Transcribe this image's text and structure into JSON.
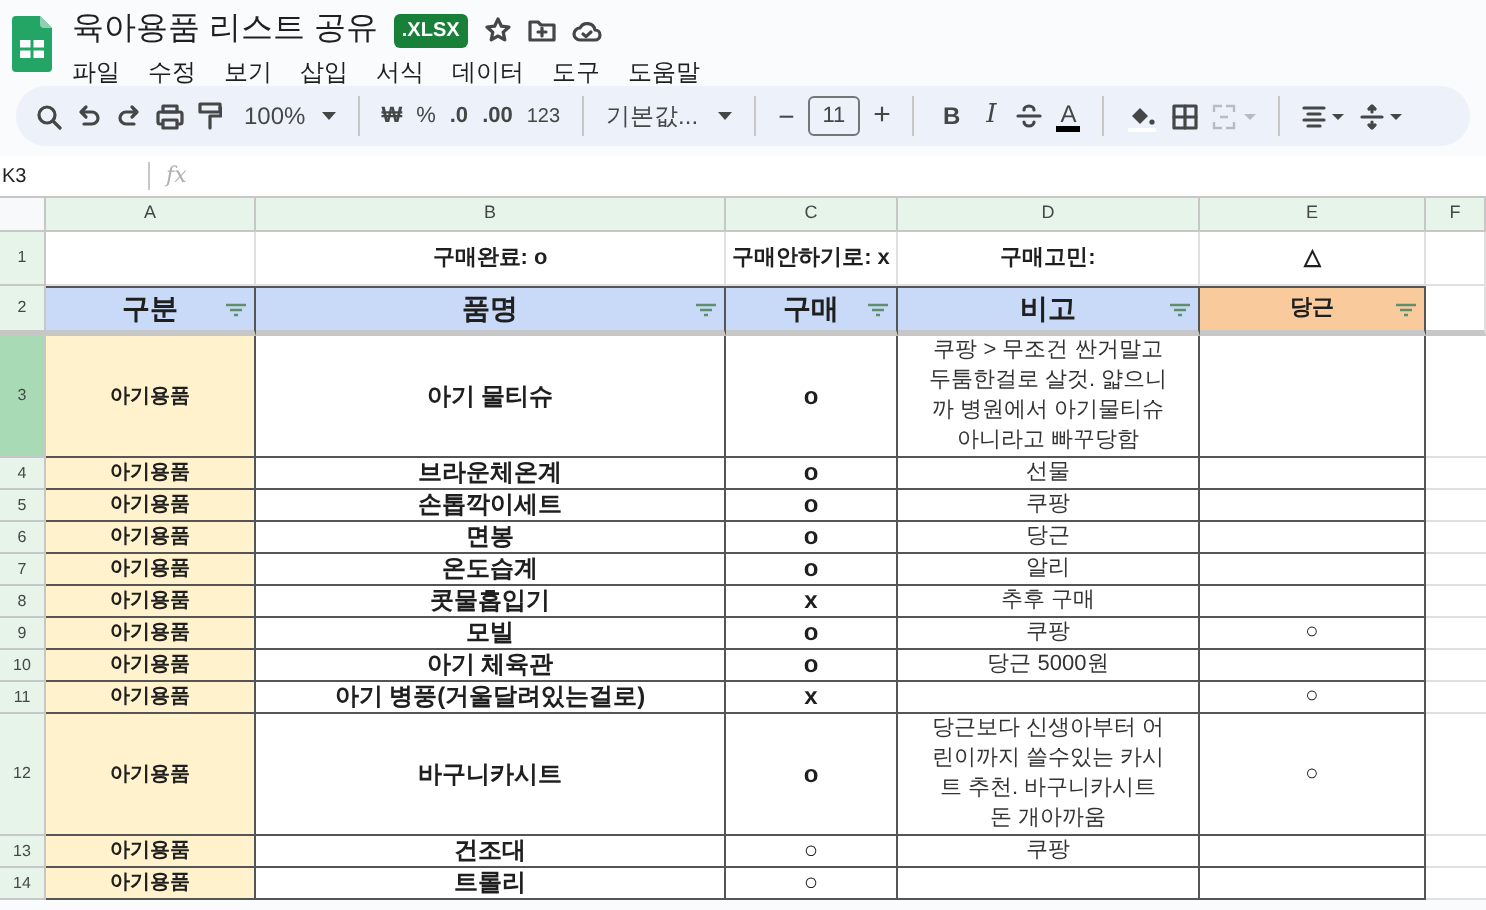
{
  "app": {
    "title": "육아용품 리스트 공유",
    "badge": ".XLSX",
    "menu": [
      "파일",
      "수정",
      "보기",
      "삽입",
      "서식",
      "데이터",
      "도구",
      "도움말"
    ]
  },
  "toolbar": {
    "zoom": "100%",
    "currency": "₩",
    "percent": "%",
    "decrease_decimal": ".0",
    "increase_decimal": ".00",
    "number_format": "123",
    "font": "기본값...",
    "font_size_minus": "−",
    "font_size": "11",
    "font_size_plus": "+",
    "bold": "B",
    "italic": "I",
    "text_color": "A"
  },
  "formula_bar": {
    "cell_ref": "K3",
    "fx": "fx"
  },
  "sheet": {
    "columns": [
      "A",
      "B",
      "C",
      "D",
      "E",
      "F"
    ],
    "rows": [
      {
        "number": "1",
        "kind": "legend",
        "cells": [
          "",
          "구매완료: o",
          "구매안하기로: x",
          "구매고민:",
          "△",
          ""
        ]
      },
      {
        "number": "2",
        "kind": "header",
        "cells": [
          "구분",
          "품명",
          "구매",
          "비고",
          "당근",
          ""
        ]
      },
      {
        "number": "3",
        "kind": "data",
        "cells": [
          "아기용품",
          "아기 물티슈",
          "o",
          "쿠팡 > 무조건 싼거말고 두툼한걸로 살것. 얇으니까 병원에서 아기물티슈 아니라고 빠꾸당함",
          "",
          ""
        ]
      },
      {
        "number": "4",
        "kind": "data",
        "cells": [
          "아기용품",
          "브라운체온계",
          "o",
          "선물",
          "",
          ""
        ]
      },
      {
        "number": "5",
        "kind": "data",
        "cells": [
          "아기용품",
          "손톱깍이세트",
          "o",
          "쿠팡",
          "",
          ""
        ]
      },
      {
        "number": "6",
        "kind": "data",
        "cells": [
          "아기용품",
          "면봉",
          "o",
          "당근",
          "",
          ""
        ]
      },
      {
        "number": "7",
        "kind": "data",
        "cells": [
          "아기용품",
          "온도습계",
          "o",
          "알리",
          "",
          ""
        ]
      },
      {
        "number": "8",
        "kind": "data",
        "cells": [
          "아기용품",
          "콧물흡입기",
          "x",
          "추후 구매",
          "",
          ""
        ]
      },
      {
        "number": "9",
        "kind": "data",
        "cells": [
          "아기용품",
          "모빌",
          "o",
          "쿠팡",
          "○",
          ""
        ]
      },
      {
        "number": "10",
        "kind": "data",
        "cells": [
          "아기용품",
          "아기 체육관",
          "o",
          "당근 5000원",
          "",
          ""
        ]
      },
      {
        "number": "11",
        "kind": "data",
        "cells": [
          "아기용품",
          "아기 병풍(거울달려있는걸로)",
          "x",
          "",
          "○",
          ""
        ]
      },
      {
        "number": "12",
        "kind": "data",
        "cells": [
          "아기용품",
          "바구니카시트",
          "o",
          "당근보다 신생아부터 어린이까지 쓸수있는 카시트 추천. 바구니카시트 돈 개아까움",
          "○",
          ""
        ]
      },
      {
        "number": "13",
        "kind": "data",
        "cells": [
          "아기용품",
          "건조대",
          "○",
          "쿠팡",
          "",
          ""
        ]
      },
      {
        "number": "14",
        "kind": "data",
        "cells": [
          "아기용품",
          "트롤리",
          "○",
          "",
          "",
          ""
        ]
      }
    ]
  }
}
